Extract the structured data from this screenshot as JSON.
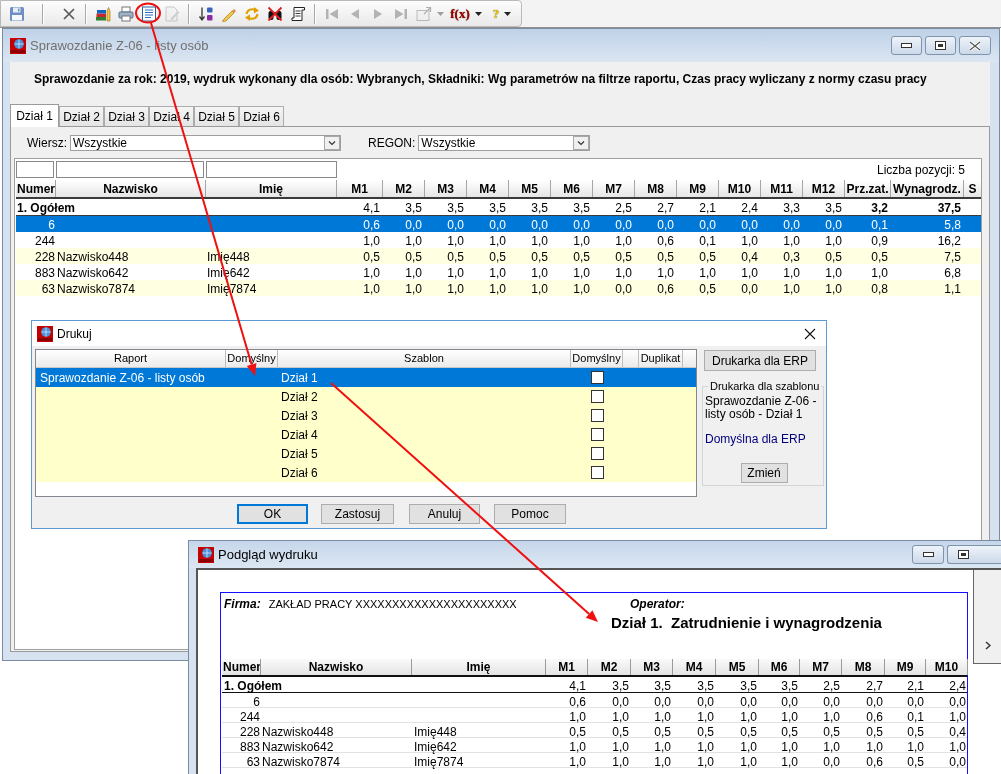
{
  "toolbar": [
    {
      "kind": "button",
      "disabled": false
    },
    {
      "kind": "separator"
    },
    {
      "kind": "button",
      "disabled": false
    },
    {
      "kind": "separator"
    },
    {
      "kind": "button",
      "disabled": false
    },
    {
      "kind": "button",
      "disabled": false
    },
    {
      "kind": "button",
      "disabled": false
    },
    {
      "kind": "button",
      "disabled": true
    },
    {
      "kind": "separator"
    },
    {
      "kind": "button",
      "disabled": false
    },
    {
      "kind": "button",
      "disabled": false
    },
    {
      "kind": "button",
      "disabled": false
    },
    {
      "kind": "button",
      "disabled": false
    },
    {
      "kind": "button",
      "disabled": false
    },
    {
      "kind": "separator"
    },
    {
      "kind": "button",
      "disabled": true
    },
    {
      "kind": "button",
      "disabled": true
    },
    {
      "kind": "button",
      "disabled": true
    },
    {
      "kind": "button",
      "disabled": true
    },
    {
      "kind": "button",
      "disabled": true,
      "dropdown": true
    },
    {
      "kind": "button",
      "disabled": false,
      "dropdown": true,
      "label": "f(x)",
      "color": "#a00000"
    },
    {
      "kind": "button",
      "disabled": false,
      "dropdown": true,
      "label": "?",
      "color": "#f2d200"
    }
  ],
  "main_window": {
    "title": "Sprawozdanie Z-06 - listy osób",
    "heading": "Sprawozdanie za rok: 2019, wydruk wykonany dla osób: Wybranych, Składniki: Wg parametrów na filtrze raportu, Czas pracy wyliczany z normy czasu pracy",
    "tabs": [
      {
        "label": "Dział 1",
        "selected": true
      },
      {
        "label": "Dział 2",
        "selected": false
      },
      {
        "label": "Dział 3",
        "selected": false
      },
      {
        "label": "Dział 4",
        "selected": false
      },
      {
        "label": "Dział 5",
        "selected": false
      },
      {
        "label": "Dział 6",
        "selected": false
      }
    ],
    "filters": [
      {
        "label": "Wiersz:",
        "value": "Wszystkie"
      },
      {
        "label": "REGON:",
        "value": "Wszystkie"
      }
    ],
    "table": {
      "count": "Liczba pozycji: 5",
      "columns": [
        "Numer",
        "Nazwisko",
        "Imię",
        "M1",
        "M2",
        "M3",
        "M4",
        "M5",
        "M6",
        "M7",
        "M8",
        "M9",
        "M10",
        "M11",
        "M12",
        "Prz.zat.",
        "Wynagrodz.",
        "S"
      ],
      "total": {
        "label": "1. Ogółem",
        "values": [
          "4,1",
          "3,5",
          "3,5",
          "3,5",
          "3,5",
          "3,5",
          "2,5",
          "2,7",
          "2,1",
          "2,4",
          "3,3",
          "3,5",
          "3,2",
          "37,5"
        ]
      },
      "rows": [
        {
          "numer": "6",
          "values": [
            "0,6",
            "0,0",
            "0,0",
            "0,0",
            "0,0",
            "0,0",
            "0,0",
            "0,0",
            "0,0",
            "0,0",
            "0,0",
            "0,0",
            "0,1",
            "5,8"
          ],
          "selected": true
        },
        {
          "numer": "244",
          "values": [
            "1,0",
            "1,0",
            "1,0",
            "1,0",
            "1,0",
            "1,0",
            "1,0",
            "0,6",
            "0,1",
            "1,0",
            "1,0",
            "1,0",
            "0,9",
            "16,2"
          ],
          "selected": false
        },
        {
          "numer": "228",
          "nazwisko": "Nazwisko448",
          "imie": "Imię448",
          "values": [
            "0,5",
            "0,5",
            "0,5",
            "0,5",
            "0,5",
            "0,5",
            "0,5",
            "0,5",
            "0,5",
            "0,4",
            "0,3",
            "0,5",
            "0,5",
            "7,5"
          ],
          "selected": false
        },
        {
          "numer": "883",
          "nazwisko": "Nazwisko642",
          "imie": "Imię642",
          "values": [
            "1,0",
            "1,0",
            "1,0",
            "1,0",
            "1,0",
            "1,0",
            "1,0",
            "1,0",
            "1,0",
            "1,0",
            "1,0",
            "1,0",
            "1,0",
            "6,8"
          ],
          "selected": false
        },
        {
          "numer": "63",
          "nazwisko": "Nazwisko7874",
          "imie": "Imię7874",
          "values": [
            "1,0",
            "1,0",
            "1,0",
            "1,0",
            "1,0",
            "1,0",
            "0,0",
            "0,6",
            "0,5",
            "0,0",
            "1,0",
            "1,0",
            "0,8",
            "1,1"
          ],
          "selected": false
        }
      ]
    }
  },
  "print_dialog": {
    "title": "Drukuj",
    "columns": [
      "Raport",
      "Domyślny",
      "Szablon",
      "Domyślny",
      "Duplikat"
    ],
    "rows": [
      {
        "raport": "Sprawozdanie Z-06 - listy osób",
        "szablon": "Dział 1",
        "checked": false,
        "selected": true
      },
      {
        "szablon": "Dział 2",
        "checked": false,
        "selected": false
      },
      {
        "szablon": "Dział 3",
        "checked": false,
        "selected": false
      },
      {
        "szablon": "Dział 4",
        "checked": false,
        "selected": false
      },
      {
        "szablon": "Dział 5",
        "checked": false,
        "selected": false
      },
      {
        "szablon": "Dział 6",
        "checked": false,
        "selected": false
      }
    ],
    "printer_button": "Drukarka dla ERP",
    "template_group": {
      "title": "Drukarka dla szablonu",
      "text": "Sprawozdanie Z-06 - listy osób - Dział 1",
      "printer": "Domyślna dla ERP",
      "button": "Zmień"
    },
    "buttons": [
      {
        "label": "OK",
        "focused": true
      },
      {
        "label": "Zastosuj",
        "focused": false
      },
      {
        "label": "Anuluj",
        "focused": false
      },
      {
        "label": "Pomoc",
        "focused": false
      }
    ]
  },
  "preview_window": {
    "title": "Podgląd wydruku",
    "company_label": "Firma:",
    "company": "ZAKŁAD PRACY XXXXXXXXXXXXXXXXXXXXXX",
    "operator_label": "Operator:",
    "report_title": "Dział 1.  Zatrudnienie i wynagrodzenia",
    "table": {
      "columns": [
        "Numer",
        "Nazwisko",
        "Imię",
        "M1",
        "M2",
        "M3",
        "M4",
        "M5",
        "M6",
        "M7",
        "M8",
        "M9",
        "M10"
      ],
      "total": {
        "label": "1. Ogółem",
        "values": [
          "4,1",
          "3,5",
          "3,5",
          "3,5",
          "3,5",
          "3,5",
          "2,5",
          "2,7",
          "2,1",
          "2,4"
        ]
      },
      "rows": [
        {
          "numer": "6",
          "values": [
            "0,6",
            "0,0",
            "0,0",
            "0,0",
            "0,0",
            "0,0",
            "0,0",
            "0,0",
            "0,0",
            "0,0"
          ]
        },
        {
          "numer": "244",
          "values": [
            "1,0",
            "1,0",
            "1,0",
            "1,0",
            "1,0",
            "1,0",
            "1,0",
            "0,6",
            "0,1",
            "1,0"
          ]
        },
        {
          "numer": "228",
          "nazwisko": "Nazwisko448",
          "imie": "Imię448",
          "values": [
            "0,5",
            "0,5",
            "0,5",
            "0,5",
            "0,5",
            "0,5",
            "0,5",
            "0,5",
            "0,5",
            "0,4"
          ]
        },
        {
          "numer": "883",
          "nazwisko": "Nazwisko642",
          "imie": "Imię642",
          "values": [
            "1,0",
            "1,0",
            "1,0",
            "1,0",
            "1,0",
            "1,0",
            "1,0",
            "1,0",
            "1,0",
            "1,0"
          ]
        },
        {
          "numer": "63",
          "nazwisko": "Nazwisko7874",
          "imie": "Imię7874",
          "values": [
            "1,0",
            "1,0",
            "1,0",
            "1,0",
            "1,0",
            "1,0",
            "0,0",
            "0,6",
            "0,5",
            "0,0"
          ]
        }
      ]
    }
  }
}
